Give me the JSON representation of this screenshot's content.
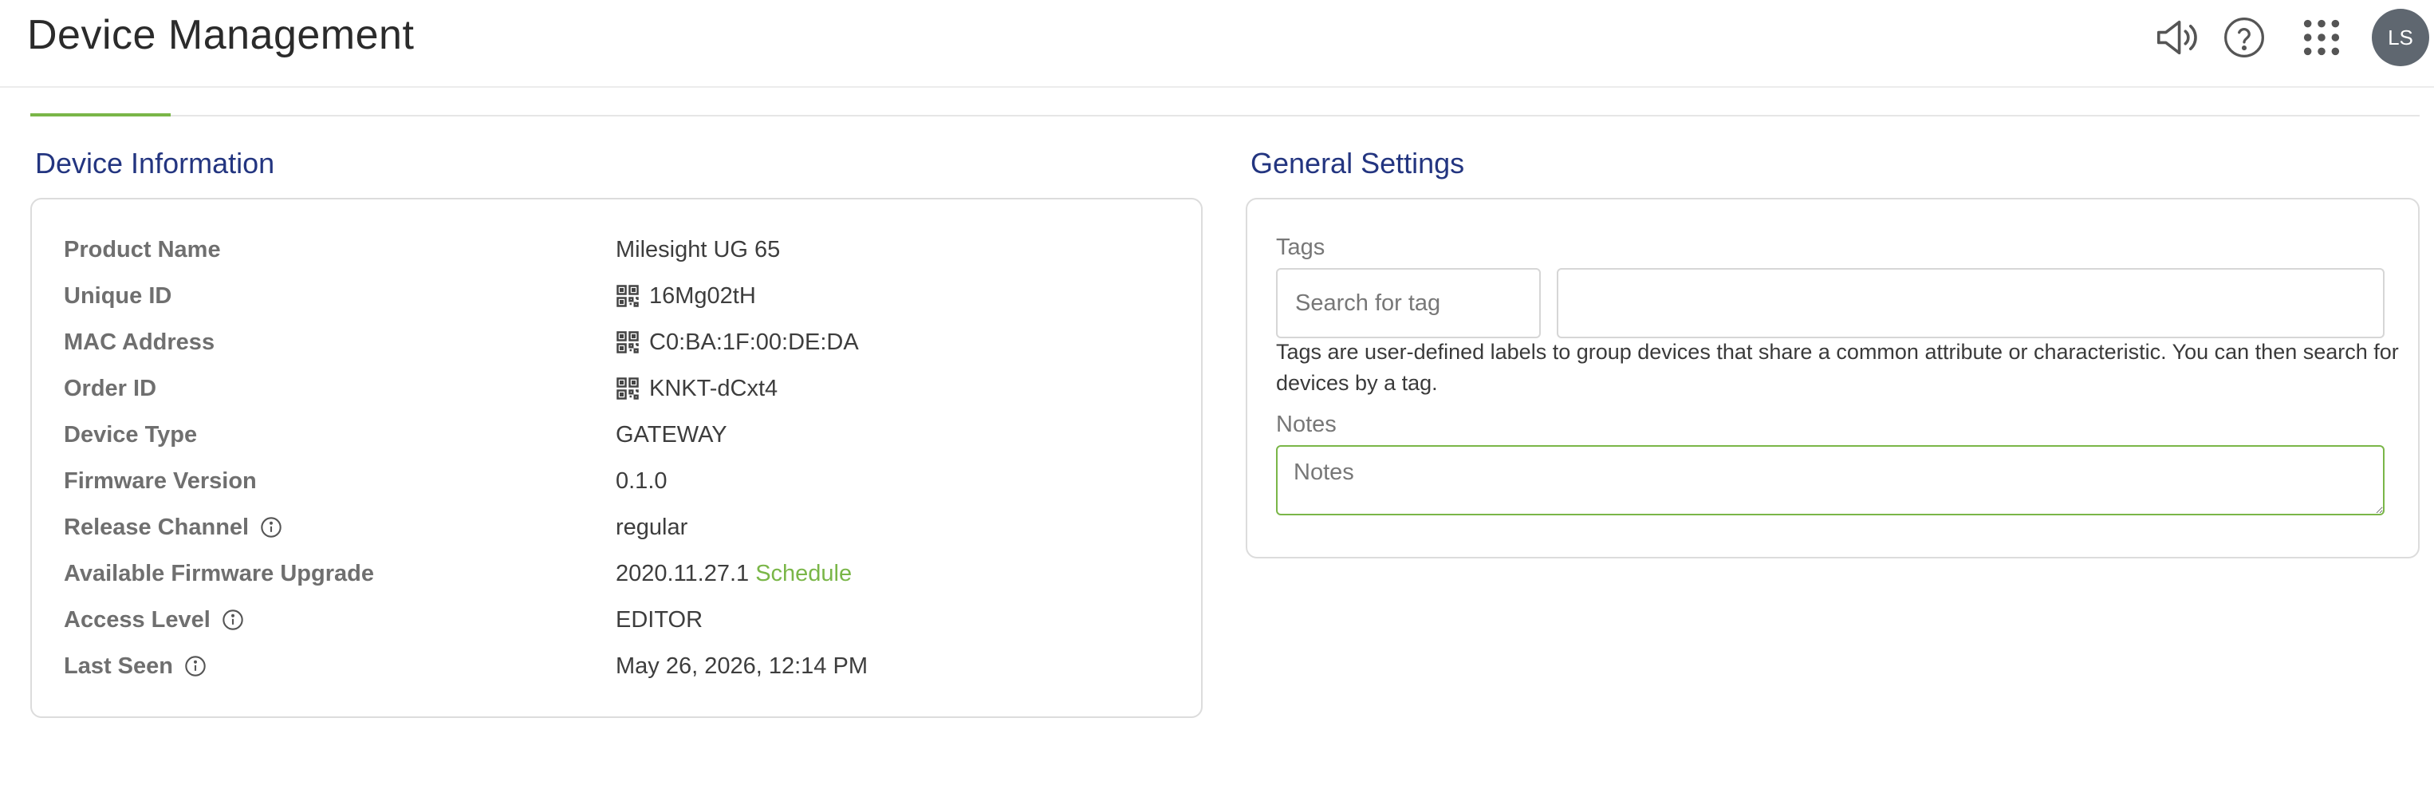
{
  "header": {
    "title": "Device Management",
    "icons": [
      "megaphone-icon",
      "help-icon",
      "apps-grid-icon"
    ],
    "avatar_initials": "LS"
  },
  "device_info": {
    "title": "Device Information",
    "rows": [
      {
        "label": "Product Name",
        "value": "Milesight UG 65"
      },
      {
        "label": "Unique ID",
        "value": "16Mg02tH"
      },
      {
        "label": "MAC Address",
        "value": "C0:BA:1F:00:DE:DA"
      },
      {
        "label": "Order ID",
        "value": "KNKT-dCxt4"
      },
      {
        "label": "Device Type",
        "value": "GATEWAY"
      },
      {
        "label": "Firmware Version",
        "value": "0.1.0"
      },
      {
        "label": "Release Channel",
        "value": "regular"
      },
      {
        "label": "Available Firmware Upgrade",
        "value": "2020.11.27.1",
        "link": "Schedule"
      },
      {
        "label": "Access Level",
        "value": "EDITOR"
      },
      {
        "label": "Last Seen",
        "value": "May 26, 2026, 12:14 PM"
      }
    ]
  },
  "general_settings": {
    "title": "General Settings",
    "tags_label": "Tags",
    "tags_placeholder": "Search for tag",
    "tags_value": "",
    "tags_help": "Tags are user-defined labels to group devices that share a common attribute or characteristic. You can then search for devices by a tag.",
    "notes_label": "Notes",
    "notes_placeholder": "Notes"
  },
  "colors": {
    "accent": "#7ab648",
    "section_title": "#233580",
    "avatar_bg": "#5f6770"
  }
}
